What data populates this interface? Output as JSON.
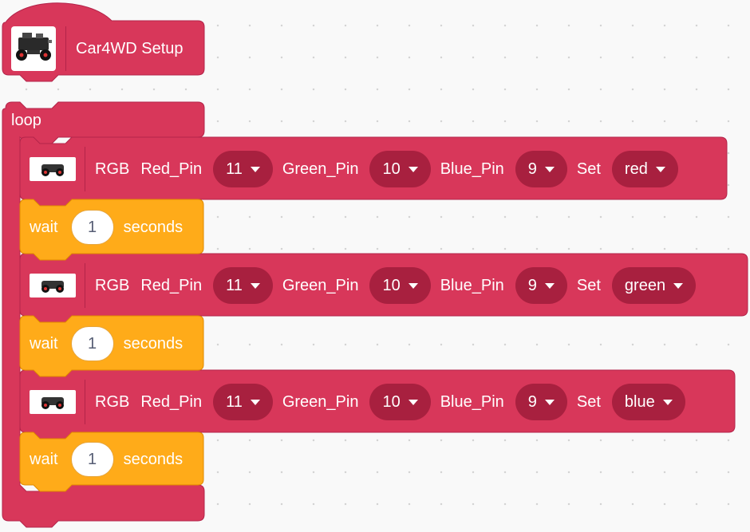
{
  "setup_block": {
    "image_icon": "robot-car-photo",
    "label": "Car4WD Setup"
  },
  "loop_block": {
    "label": "loop"
  },
  "rgb_blocks": [
    {
      "icon": "car-icon",
      "label": "RGB",
      "red_pin_label": "Red_Pin",
      "red_pin_value": "11",
      "green_pin_label": "Green_Pin",
      "green_pin_value": "10",
      "blue_pin_label": "Blue_Pin",
      "blue_pin_value": "9",
      "set_label": "Set",
      "color_value": "red"
    },
    {
      "icon": "car-icon",
      "label": "RGB",
      "red_pin_label": "Red_Pin",
      "red_pin_value": "11",
      "green_pin_label": "Green_Pin",
      "green_pin_value": "10",
      "blue_pin_label": "Blue_Pin",
      "blue_pin_value": "9",
      "set_label": "Set",
      "color_value": "green"
    },
    {
      "icon": "car-icon",
      "label": "RGB",
      "red_pin_label": "Red_Pin",
      "red_pin_value": "11",
      "green_pin_label": "Green_Pin",
      "green_pin_value": "10",
      "blue_pin_label": "Blue_Pin",
      "blue_pin_value": "9",
      "set_label": "Set",
      "color_value": "blue"
    }
  ],
  "wait_blocks": [
    {
      "label": "wait",
      "value": "1",
      "unit": "seconds"
    },
    {
      "label": "wait",
      "value": "1",
      "unit": "seconds"
    },
    {
      "label": "wait",
      "value": "1",
      "unit": "seconds"
    }
  ],
  "colors": {
    "block": "#d8375a",
    "block_dark": "#a8203f",
    "wait": "#ffab19",
    "canvas": "#f9f9f9"
  }
}
